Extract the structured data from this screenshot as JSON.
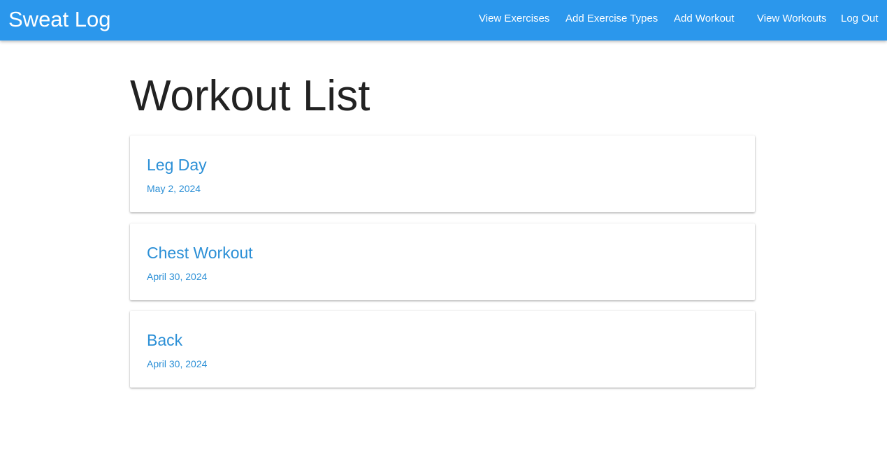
{
  "navbar": {
    "brand": "Sweat Log",
    "links": [
      {
        "label": "View Exercises"
      },
      {
        "label": "Add Exercise Types"
      },
      {
        "label": "Add Workout"
      },
      {
        "label": "View Workouts"
      },
      {
        "label": "Log Out"
      }
    ],
    "background_color": "#2b97ec"
  },
  "main": {
    "title": "Workout List",
    "workouts": [
      {
        "name": "Leg Day",
        "date": "May 2, 2024"
      },
      {
        "name": "Chest Workout",
        "date": "April 30, 2024"
      },
      {
        "name": "Back",
        "date": "April 30, 2024"
      }
    ]
  },
  "colors": {
    "accent": "#2b8fd6",
    "title_text": "#222222"
  }
}
